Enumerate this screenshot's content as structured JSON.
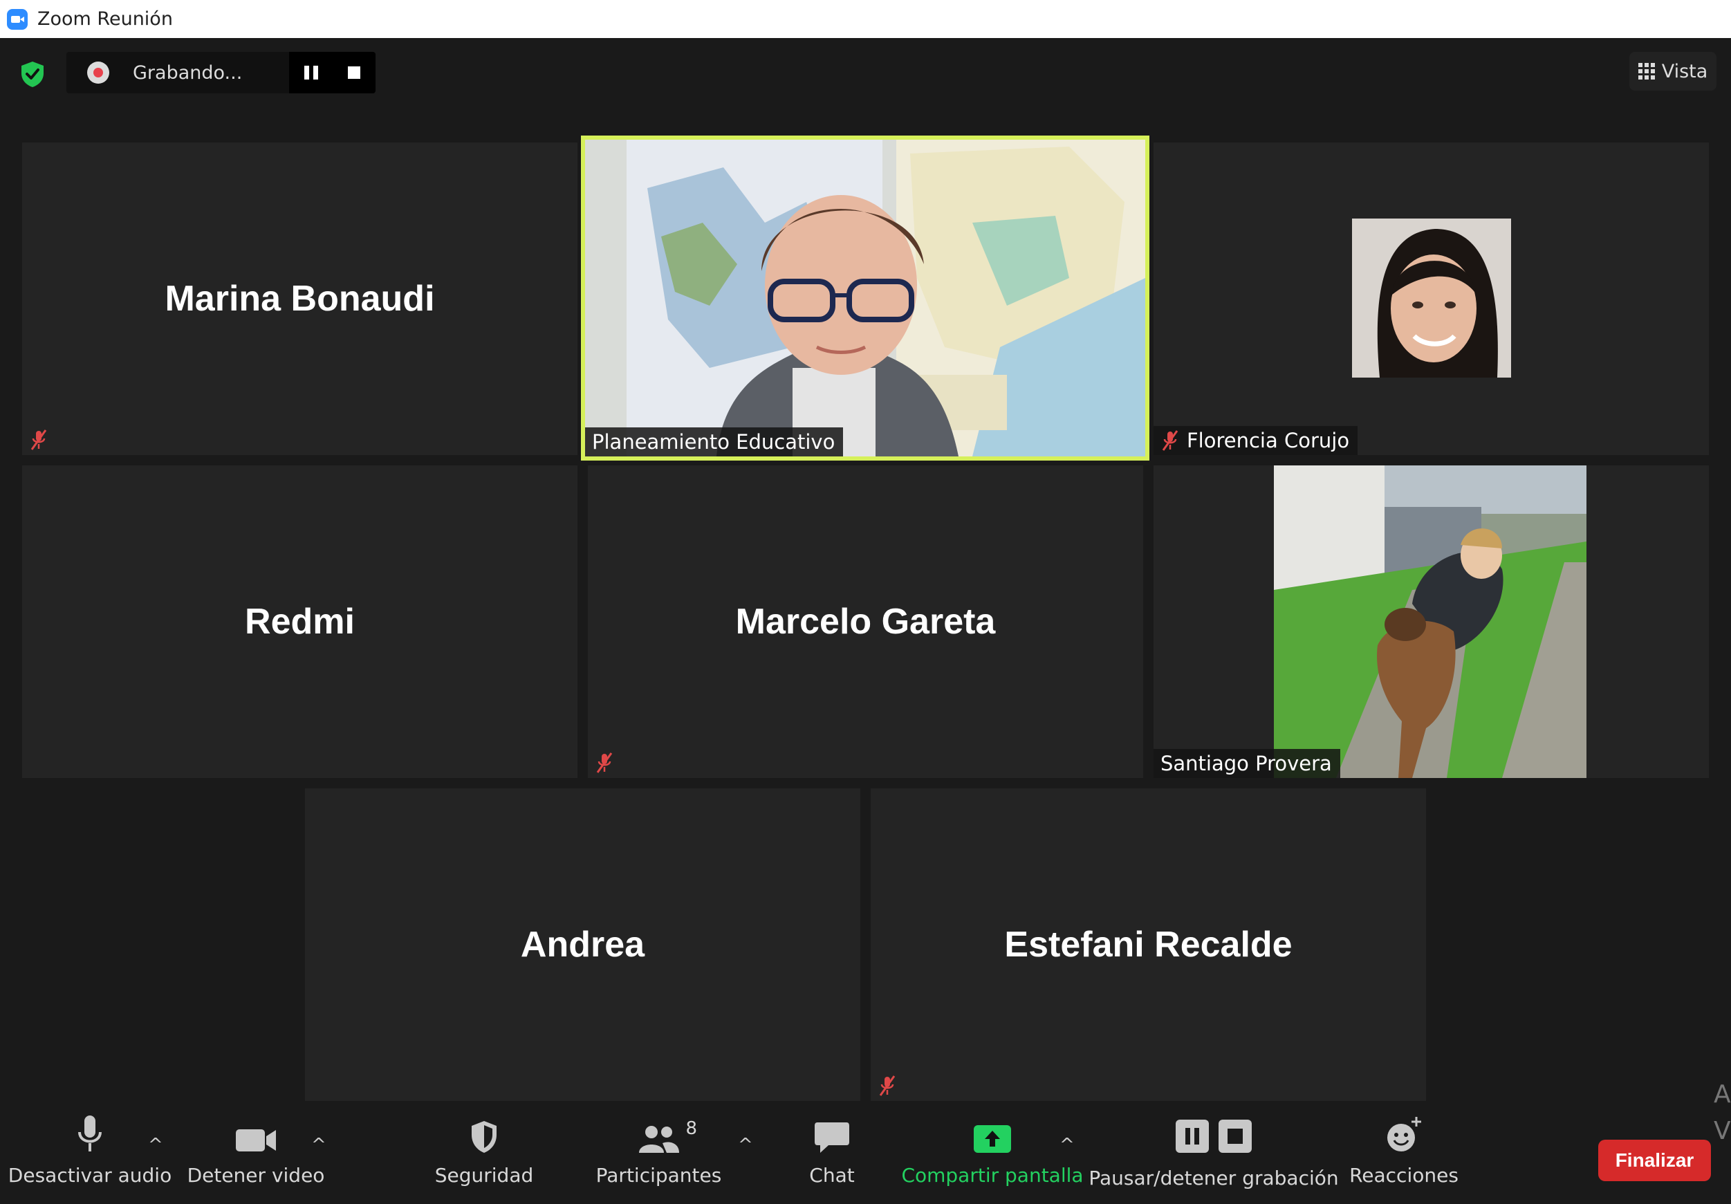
{
  "window": {
    "title": "Zoom Reunión"
  },
  "topbar": {
    "recording_label": "Grabando...",
    "view_label": "Vista"
  },
  "participants": [
    {
      "name": "Marina Bonaudi",
      "display": "name",
      "muted": true
    },
    {
      "name": "Planeamiento Educativo",
      "display": "video",
      "muted": false,
      "active_speaker": true
    },
    {
      "name": "Florencia Corujo",
      "display": "photo",
      "muted": true
    },
    {
      "name": "Redmi",
      "display": "name",
      "muted": false
    },
    {
      "name": "Marcelo Gareta",
      "display": "name",
      "muted": true
    },
    {
      "name": "Santiago Provera",
      "display": "photo",
      "muted": false
    },
    {
      "name": "Andrea",
      "display": "name",
      "muted": false
    },
    {
      "name": "Estefani Recalde",
      "display": "name",
      "muted": true
    }
  ],
  "toolbar": {
    "audio_label": "Desactivar audio",
    "video_label": "Detener video",
    "security_label": "Seguridad",
    "participants_label": "Participantes",
    "participants_count": "8",
    "chat_label": "Chat",
    "share_label": "Compartir pantalla",
    "recording_label": "Pausar/detener grabación",
    "reactions_label": "Reacciones",
    "end_label": "Finalizar"
  },
  "edge_glyphs": {
    "top": "A",
    "bottom": "V"
  },
  "colors": {
    "active_border": "#d6f05a",
    "share_green": "#23d160",
    "end_red": "#d62a2a",
    "mute_red": "#e04848",
    "shield_green": "#23c552"
  }
}
